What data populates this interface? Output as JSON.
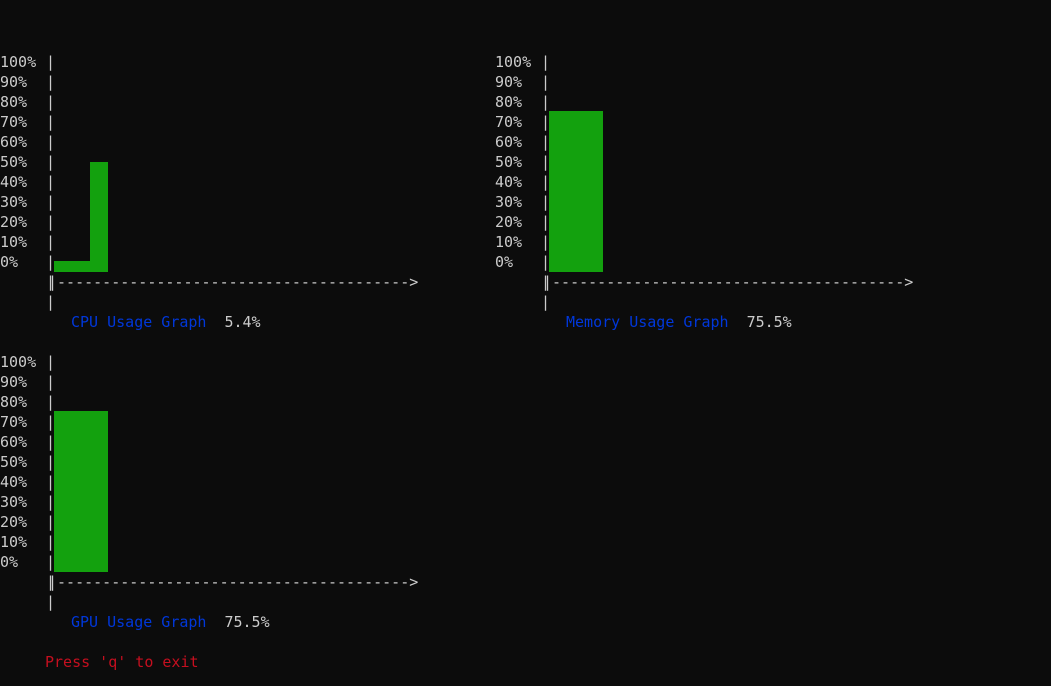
{
  "ticks": [
    "100%",
    "90%",
    "80%",
    "70%",
    "60%",
    "50%",
    "40%",
    "30%",
    "20%",
    "10%",
    "0%"
  ],
  "x_axis_line": "|--------------------------------------->",
  "graphs": {
    "cpu": {
      "title": "CPU Usage Graph",
      "value": "5.4%",
      "bars": [
        5.4,
        55
      ]
    },
    "memory": {
      "title": "Memory Usage Graph",
      "value": "75.5%",
      "bars": [
        75.5
      ]
    },
    "gpu": {
      "title": "GPU Usage Graph",
      "value": "75.5%",
      "bars": [
        75.5
      ]
    }
  },
  "footer": "Press 'q' to exit",
  "colors": {
    "background": "#0c0c0c",
    "bar": "#13a10e",
    "title": "#0037da",
    "text": "#cccccc",
    "exit": "#c50f1f"
  }
}
